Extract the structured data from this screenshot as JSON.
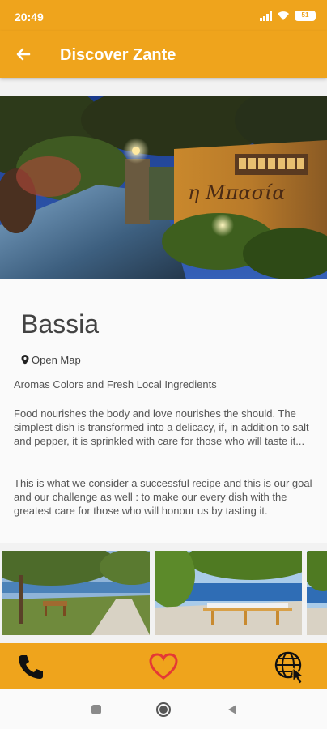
{
  "status_bar": {
    "time": "20:49",
    "battery": "51",
    "icons": [
      "signal-icon",
      "wifi-icon",
      "battery-icon"
    ]
  },
  "app_bar": {
    "title": "Discover Zante",
    "back_icon": "arrow-left-icon"
  },
  "place": {
    "name": "Bassia",
    "open_map_label": "Open Map",
    "tagline": "Aromas Colors and Fresh Local Ingredients",
    "description_1": "Food nourishes the body and love nourishes the should. The simplest dish is transformed into a delicacy, if, in addition to salt and pepper, it is sprinkled with care for those who will taste it...",
    "description_2": "This is what we consider a successful recipe and this is our goal and our challenge as well : to make our every dish with the greatest care for those who will honour us by tasting it."
  },
  "hero_sign_text": "η Μπασία",
  "gallery": {
    "count": 3
  },
  "bottom_bar": {
    "icons": [
      "phone-icon",
      "heart-icon",
      "globe-click-icon"
    ]
  },
  "colors": {
    "accent": "#efa41c",
    "heart": "#e53935",
    "text": "#424242"
  }
}
